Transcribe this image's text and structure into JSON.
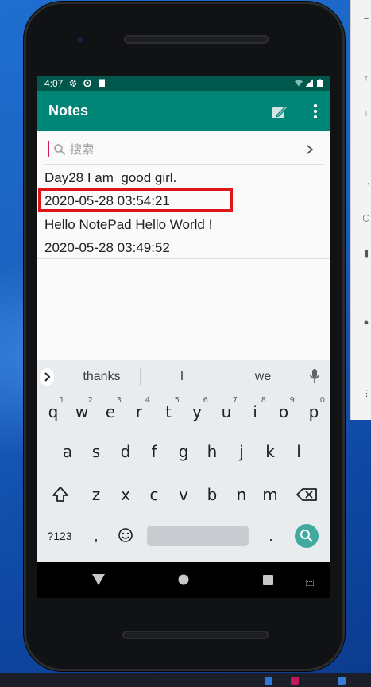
{
  "status_bar": {
    "time": "4:07"
  },
  "app_bar": {
    "title": "Notes",
    "icons": [
      "compose-icon",
      "more-vert-icon"
    ]
  },
  "search": {
    "placeholder": "搜索",
    "value": ""
  },
  "notes": [
    {
      "title": "Day28 I am  good girl.",
      "date": "2020-05-28 03:54:21",
      "highlighted": true
    },
    {
      "title": "Hello NotePad Hello World !",
      "date": "2020-05-28 03:49:52",
      "highlighted": false
    }
  ],
  "keyboard": {
    "suggestions": [
      "thanks",
      "I",
      "we"
    ],
    "row1": [
      "q",
      "w",
      "e",
      "r",
      "t",
      "y",
      "u",
      "i",
      "o",
      "p"
    ],
    "row1_hints": [
      "1",
      "2",
      "3",
      "4",
      "5",
      "6",
      "7",
      "8",
      "9",
      "0"
    ],
    "row2": [
      "a",
      "s",
      "d",
      "f",
      "g",
      "h",
      "j",
      "k",
      "l"
    ],
    "row3": [
      "z",
      "x",
      "c",
      "v",
      "b",
      "n",
      "m"
    ],
    "symbols_key": "?123",
    "comma_key": ",",
    "period_key": "."
  },
  "colors": {
    "status_bar": "#00574b",
    "app_bar": "#008577",
    "highlight_box": "#e0141b",
    "enter_key": "#41a99d",
    "desktop": "#1a5fbd"
  },
  "side_panel_glyphs": [
    "−",
    "↑",
    "↓",
    "←",
    "→",
    "⬡",
    "▮",
    "●",
    "⋮"
  ]
}
